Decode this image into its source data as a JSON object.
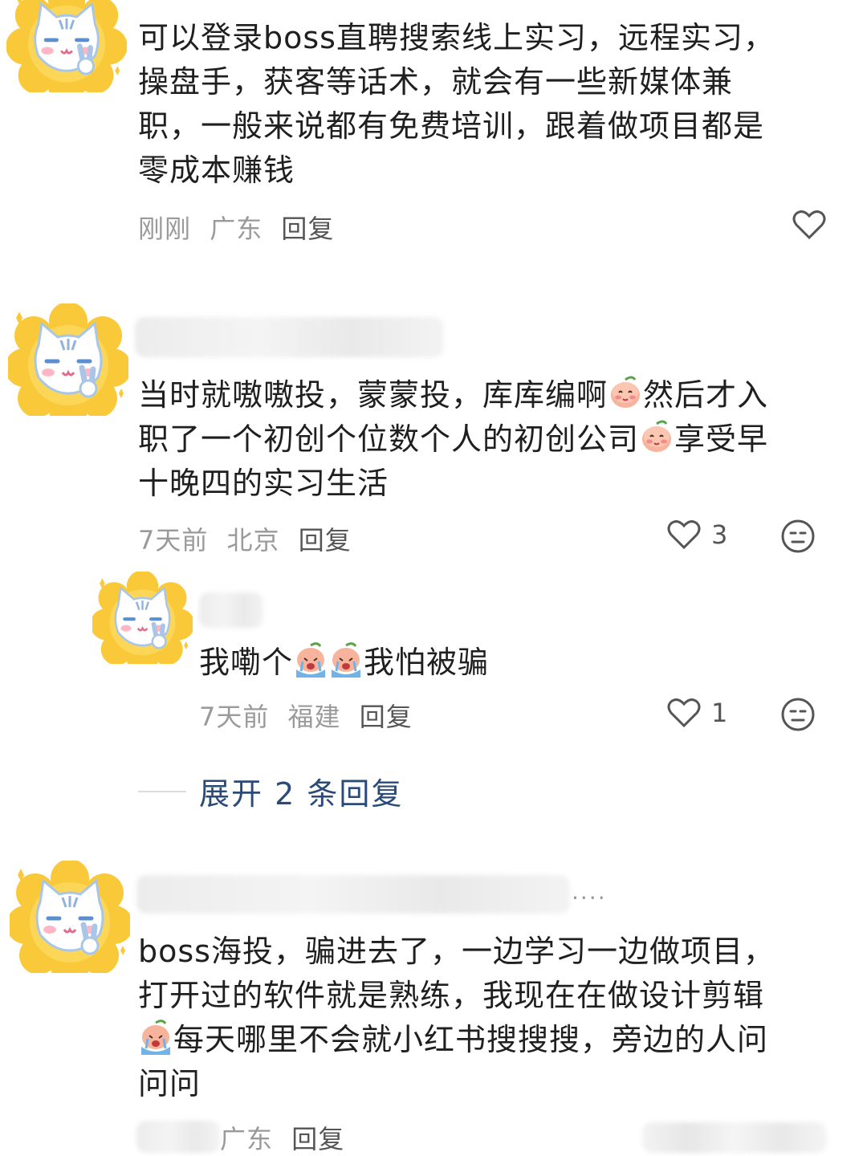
{
  "comments": [
    {
      "text_lines": [
        "可以登录boss直聘搜索线上实习，远程实习，",
        "操盘手，获客等话术，就会有一些新媒体兼",
        "职，一般来说都有免费培训，跟着做项目都是",
        "零成本赚钱"
      ],
      "time": "刚刚",
      "location": "广东",
      "reply": "回复",
      "likes": ""
    },
    {
      "text_lines": [
        "当时就嗷嗷投，蒙蒙投，库库编啊",
        "然后才入",
        "职了一个初创个位数个人的初创公司",
        "享受早",
        "十晚四的实习生活"
      ],
      "time": "7天前",
      "location": "北京",
      "reply": "回复",
      "likes": "3"
    },
    {
      "text_lines": [
        "我嘞个",
        "我怕被骗"
      ],
      "time": "7天前",
      "location": "福建",
      "reply": "回复",
      "likes": "1"
    },
    {
      "text_lines": [
        "boss海投，骗进去了，一边学习一边做项目，",
        "打开过的软件就是熟练，我现在在做设计剪辑",
        "每天哪里不会就小红书搜搜搜，旁边的人问",
        "问问"
      ],
      "time": "",
      "location": "广东",
      "reply": "回复",
      "likes": ""
    }
  ],
  "expand_replies": "展开 2 条回复",
  "ellipsis": "....",
  "colors": {
    "avatar_flower": "#f9c93a",
    "accent_link": "#2a4a7a",
    "meta_gray": "#9a9a9a"
  },
  "icons": [
    "heart-icon",
    "emoji-face-icon",
    "blushing-peach-emoji",
    "crying-peach-emoji",
    "cat-avatar"
  ]
}
